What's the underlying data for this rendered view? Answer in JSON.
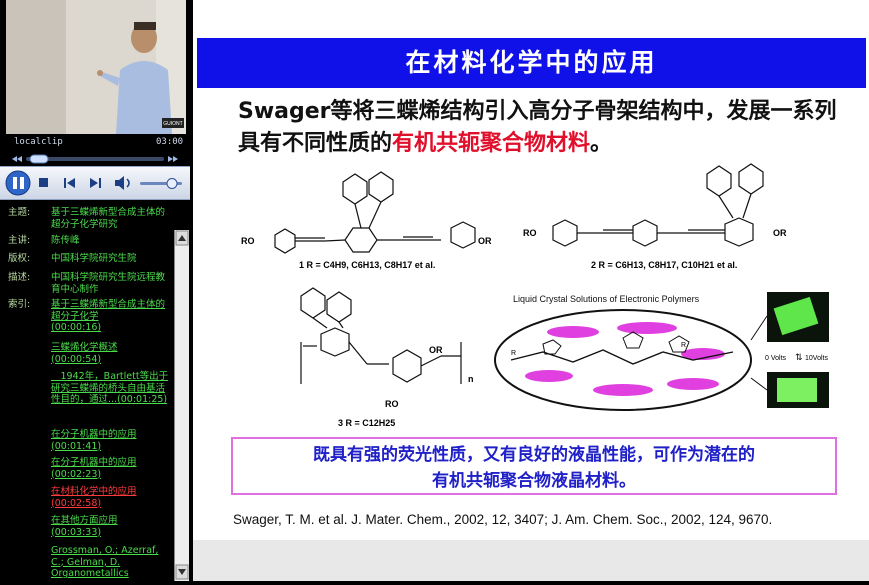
{
  "player": {
    "clip_name": "localclip",
    "clip_time": "03:00",
    "video_watermark": "GUIONT"
  },
  "info": {
    "topic_label": "主题:",
    "topic_value": "基于三蝶烯新型合成主体的超分子化学研究",
    "speaker_label": "主讲:",
    "speaker_value": "陈传峰",
    "copyright_label": "版权:",
    "copyright_value": "中国科学院研究生院",
    "desc_label": "描述:",
    "desc_value": "中国科学院研究生院远程教育中心制作",
    "index_label": "索引:",
    "index_items": [
      {
        "text": "基于三蝶烯新型合成主体的超分子化学",
        "time": "(00:00:16)"
      },
      {
        "text": "三蝶烯化学概述",
        "time": "(00:00:54)"
      },
      {
        "text": "　1942年，Bartlett等出于研究三蝶烯的桥头自由基活性目的，通过...(00:01:25)",
        "time": ""
      },
      {
        "text": "在分子机器中的应用",
        "time": "(00:01:41)"
      },
      {
        "text": "在分子机器中的应用",
        "time": "(00:02:23)"
      },
      {
        "text": "在材料化学中的应用",
        "time": "(00:02:58)"
      },
      {
        "text": "在其他方面应用",
        "time": "(00:03:33)"
      },
      {
        "text": "Grossman, O.; Azerraf, C.; Gelman, D. Organometallics",
        "time": ""
      }
    ]
  },
  "slide": {
    "title": "在材料化学中的应用",
    "para_1": "Swager等将三蝶烯结构引入高分子骨架结构中，发展一系列具有不同性质的",
    "para_red": "有机共轭聚合物材料",
    "para_2": "。",
    "compound1": "1 R = C4H9, C6H13, C8H17 et al.",
    "compound2": "2 R = C6H13, C8H17, C10H21 et al.",
    "compound3": "3 R = C12H25",
    "ro": "RO",
    "or": "OR",
    "n": "n",
    "r": "R",
    "lc_title": "Liquid Crystal  Solutions of Electronic Polymers",
    "volts0": "0 Volts",
    "volts10": "10Volts",
    "highlight_1": "既具有强的荧光性质，又有良好的液晶性能，可作为潜在的",
    "highlight_2": "有机共轭聚合物液晶材料。",
    "reference": "Swager, T. M. et al. J. Mater. Chem., 2002, 12, 3407; J. Am. Chem. Soc., 2002, 124, 9670."
  },
  "colors": {
    "banner": "#1010e8",
    "highlight_text": "#2020c8",
    "red": "#e0102c",
    "index_link": "#4bdc4b",
    "index_active": "#ff3b3b",
    "ellipse_fill": "#e040e0"
  }
}
